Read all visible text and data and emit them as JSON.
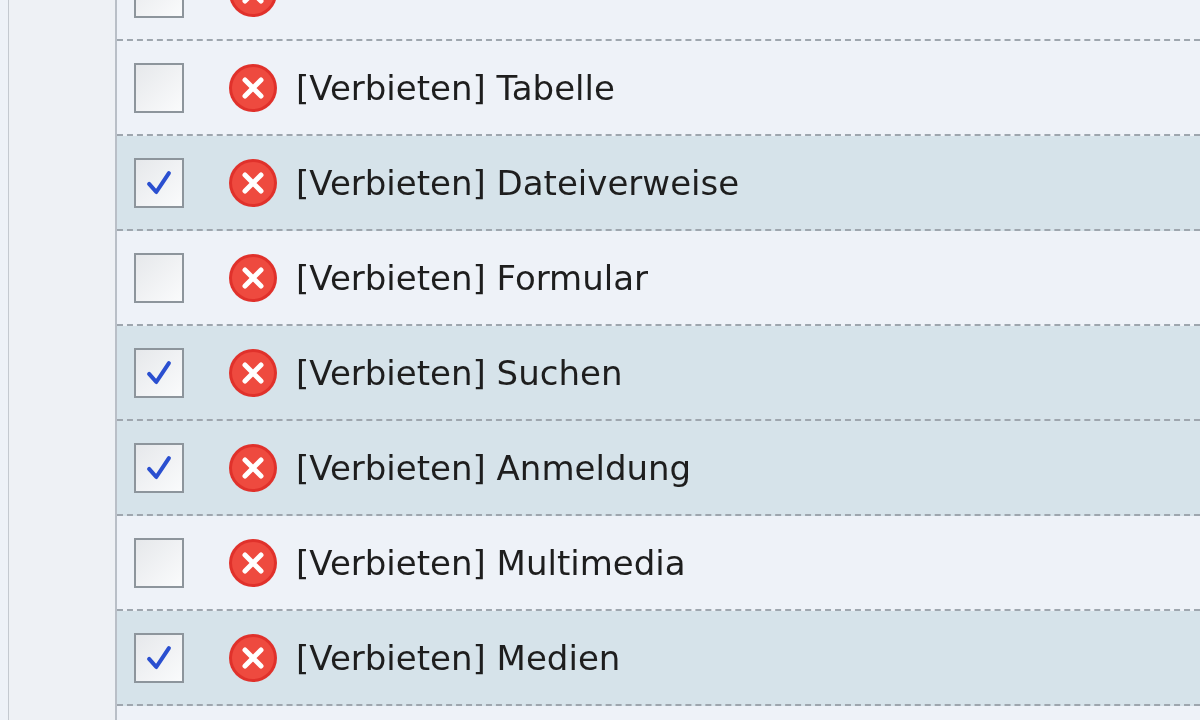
{
  "rows": [
    {
      "checked": false
    },
    {
      "checked": false,
      "label": "[Verbieten] Tabelle"
    },
    {
      "checked": true,
      "label": "[Verbieten] Dateiverweise"
    },
    {
      "checked": false,
      "label": "[Verbieten] Formular"
    },
    {
      "checked": true,
      "label": "[Verbieten] Suchen"
    },
    {
      "checked": true,
      "label": "[Verbieten] Anmeldung"
    },
    {
      "checked": false,
      "label": "[Verbieten] Multimedia"
    },
    {
      "checked": true,
      "label": "[Verbieten] Medien"
    }
  ]
}
